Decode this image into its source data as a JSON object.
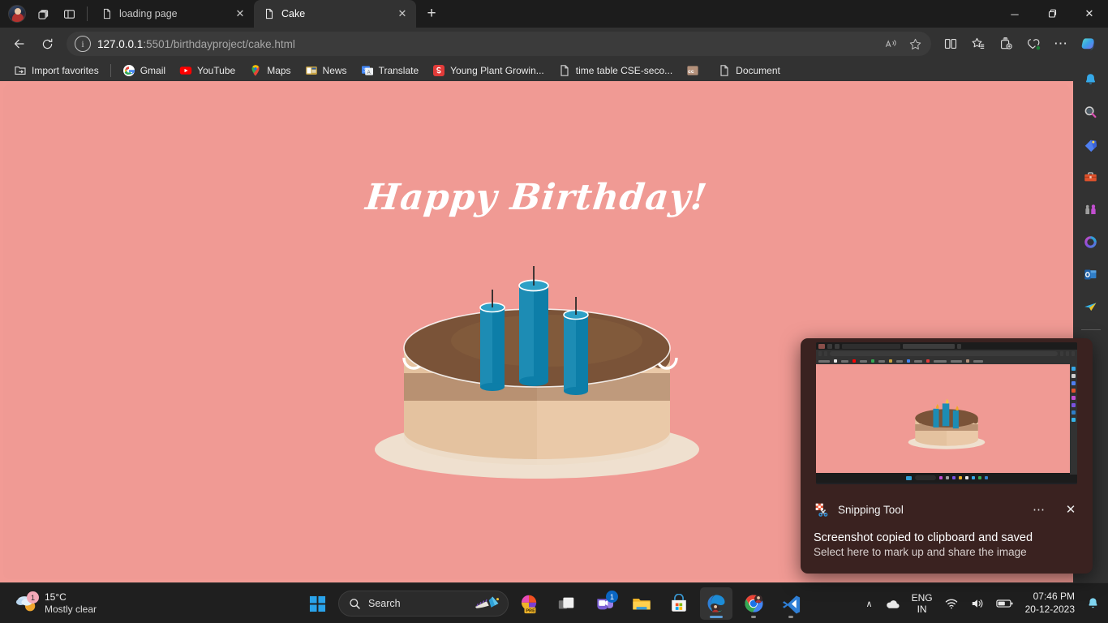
{
  "browser": {
    "tabs": [
      {
        "title": "loading page",
        "active": false,
        "icon": "page-icon"
      },
      {
        "title": "Cake",
        "active": true,
        "icon": "page-icon"
      }
    ],
    "new_tab_label": "+",
    "window_controls": {
      "minimize": "─",
      "maximize": "❐",
      "close": "✕"
    },
    "toolbar": {
      "back_label": "←",
      "refresh_label": "↻",
      "url_secure_prefix": "127.0.0.1",
      "url_rest": ":5501/birthdayproject/cake.html",
      "read_aloud_label": "Aᴺ",
      "favorite_label": "☆",
      "split_screen_label": "split-screen",
      "collections_label": "collections",
      "browser_essentials_label": "browser-essentials",
      "settings_label": "⋯"
    },
    "bookmarks": [
      {
        "label": "Import favorites",
        "icon": "import-icon"
      },
      {
        "label": "Gmail",
        "icon": "gmail-icon"
      },
      {
        "label": "YouTube",
        "icon": "youtube-icon"
      },
      {
        "label": "Maps",
        "icon": "maps-icon"
      },
      {
        "label": "News",
        "icon": "news-icon"
      },
      {
        "label": "Translate",
        "icon": "translate-icon"
      },
      {
        "label": "Young Plant Growin...",
        "icon": "scribd-icon"
      },
      {
        "label": "time table CSE-seco...",
        "icon": "page-icon"
      },
      {
        "label": "",
        "icon": "cc-icon"
      },
      {
        "label": "Document",
        "icon": "page-icon"
      }
    ],
    "sidebar_icons": [
      "bell-icon",
      "search-icon",
      "shopping-tag-icon",
      "tools-icon",
      "games-icon",
      "office-icon",
      "outlook-icon",
      "send-icon"
    ]
  },
  "page": {
    "title": "Happy Birthday!",
    "background_color": "#f09a94",
    "cake": {
      "candle_count": 3,
      "candle_color": "#1d8cb4",
      "candle_shade_color": "#0d7ea8",
      "frosting_color": "#ffffff",
      "chocolate_top_color": "#7a5338",
      "cake_body_color": "#e4c29f",
      "cake_band_color": "#b89172",
      "plate_color": "#efe0cf"
    }
  },
  "notification": {
    "app_name": "Snipping Tool",
    "title": "Screenshot copied to clipboard and saved",
    "subtitle": "Select here to mark up and share the image",
    "more_label": "⋯",
    "close_label": "✕",
    "background_color": "#3a2220"
  },
  "taskbar": {
    "weather": {
      "temperature": "15°C",
      "condition": "Mostly clear",
      "badge": "1"
    },
    "search_placeholder": "Search",
    "apps": [
      {
        "name": "powerpoint",
        "badge": "",
        "state": "idle"
      },
      {
        "name": "task-view",
        "badge": "",
        "state": "idle"
      },
      {
        "name": "teams",
        "badge": "1",
        "state": "idle"
      },
      {
        "name": "file-explorer",
        "badge": "",
        "state": "idle"
      },
      {
        "name": "microsoft-store",
        "badge": "",
        "state": "idle"
      },
      {
        "name": "edge",
        "badge": "",
        "state": "active"
      },
      {
        "name": "chrome",
        "badge": "",
        "state": "running"
      },
      {
        "name": "vs-code",
        "badge": "",
        "state": "running"
      }
    ],
    "tray": {
      "overflow_label": "∧",
      "onedrive_label": "onedrive-icon",
      "language_primary": "ENG",
      "language_secondary": "IN",
      "wifi_label": "wifi-icon",
      "volume_label": "volume-icon",
      "battery_label": "battery-icon",
      "time": "07:46 PM",
      "date": "20-12-2023",
      "notification_label": "bell-icon"
    }
  }
}
